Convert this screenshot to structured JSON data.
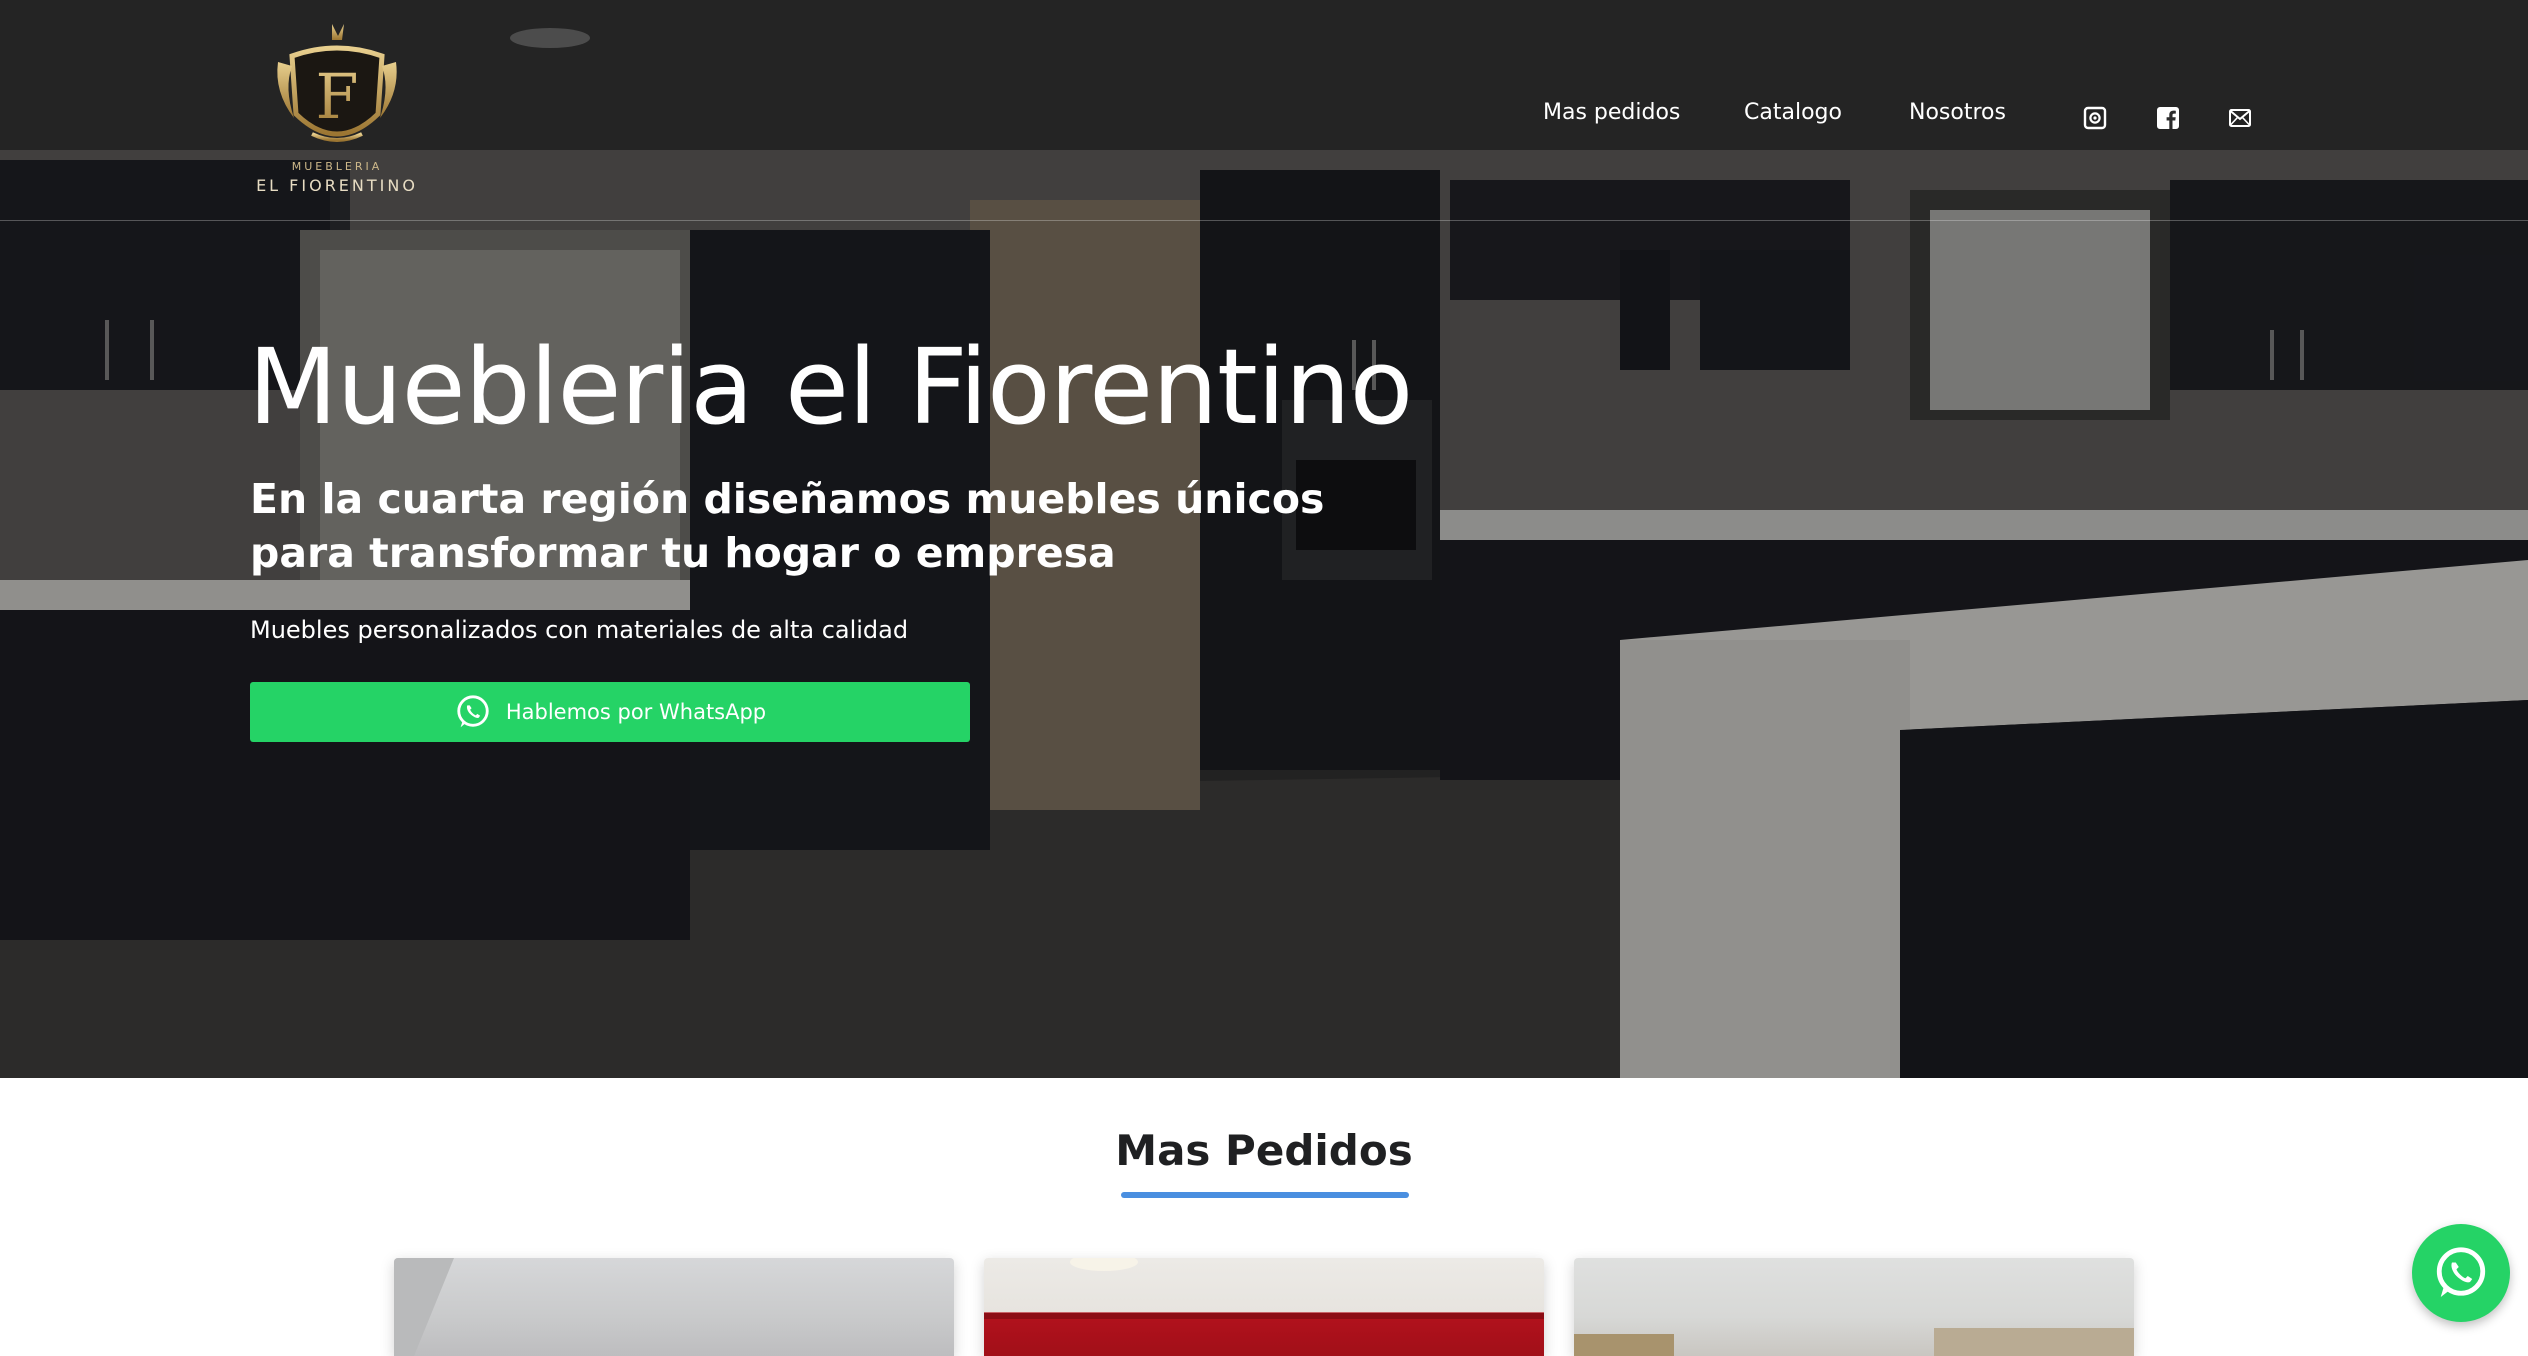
{
  "brand": {
    "logo_line1": "MUEBLERIA",
    "logo_line2": "EL FIORENTINO",
    "logo_letter": "F"
  },
  "nav": {
    "items": [
      {
        "label": "Mas pedidos"
      },
      {
        "label": "Catalogo"
      },
      {
        "label": "Nosotros"
      }
    ],
    "icons": [
      "instagram-icon",
      "facebook-icon",
      "mail-icon"
    ]
  },
  "hero": {
    "title": "Muebleria el Fiorentino",
    "subtitle": "En la cuarta región diseñamos muebles únicos para transformar tu hogar o empresa",
    "tagline": "Muebles personalizados con materiales de alta calidad",
    "cta_label": "Hablemos por WhatsApp"
  },
  "section": {
    "title": "Mas Pedidos"
  },
  "colors": {
    "whatsapp_green": "#25d366",
    "accent_blue": "#4a8fe0",
    "logo_gold": "#c9a75c"
  }
}
